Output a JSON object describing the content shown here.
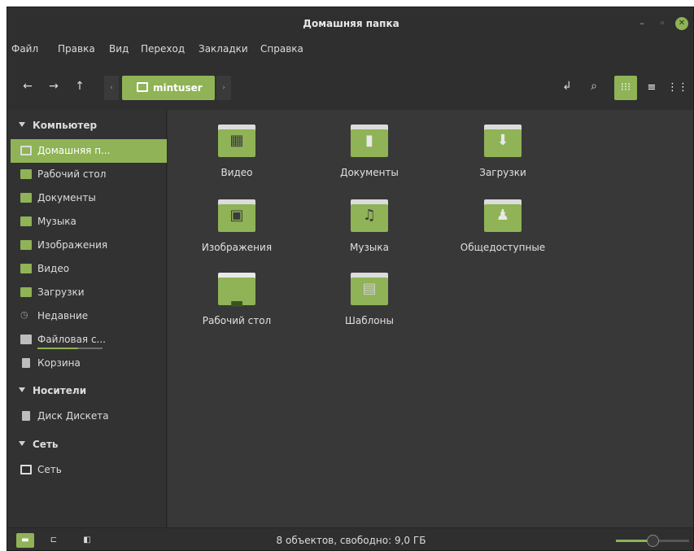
{
  "window": {
    "title": "Домашняя папка",
    "accent": "#8fb356"
  },
  "menubar": [
    "Файл",
    "Правка",
    "Вид",
    "Переход",
    "Закладки",
    "Справка"
  ],
  "location": {
    "current": "mintuser"
  },
  "sidebar": {
    "sections": [
      {
        "title": "Компьютер",
        "items": [
          {
            "label": "Домашняя п...",
            "icon": "home-folder-icon",
            "selected": true
          },
          {
            "label": "Рабочий стол",
            "icon": "desktop-folder-icon"
          },
          {
            "label": "Документы",
            "icon": "documents-folder-icon"
          },
          {
            "label": "Музыка",
            "icon": "music-folder-icon"
          },
          {
            "label": "Изображения",
            "icon": "pictures-folder-icon"
          },
          {
            "label": "Видео",
            "icon": "video-folder-icon"
          },
          {
            "label": "Загрузки",
            "icon": "downloads-folder-icon"
          },
          {
            "label": "Недавние",
            "icon": "recent-icon"
          },
          {
            "label": "Файловая с...",
            "icon": "filesystem-icon"
          },
          {
            "label": "Корзина",
            "icon": "trash-icon"
          }
        ]
      },
      {
        "title": "Носители",
        "items": [
          {
            "label": "Диск Дискета",
            "icon": "floppy-icon"
          }
        ]
      },
      {
        "title": "Сеть",
        "items": [
          {
            "label": "Сеть",
            "icon": "network-icon"
          }
        ]
      }
    ]
  },
  "files": [
    {
      "name": "Видео",
      "icon": "video-folder-icon"
    },
    {
      "name": "Документы",
      "icon": "documents-folder-icon"
    },
    {
      "name": "Загрузки",
      "icon": "downloads-folder-icon"
    },
    {
      "name": "Изображения",
      "icon": "pictures-folder-icon"
    },
    {
      "name": "Музыка",
      "icon": "music-folder-icon"
    },
    {
      "name": "Общедоступные",
      "icon": "public-folder-icon"
    },
    {
      "name": "Рабочий стол",
      "icon": "desktop-folder-icon"
    },
    {
      "name": "Шаблоны",
      "icon": "templates-folder-icon"
    }
  ],
  "status": {
    "text": "8 объектов, свободно: 9,0 ГБ",
    "zoom_fraction": 0.5
  }
}
